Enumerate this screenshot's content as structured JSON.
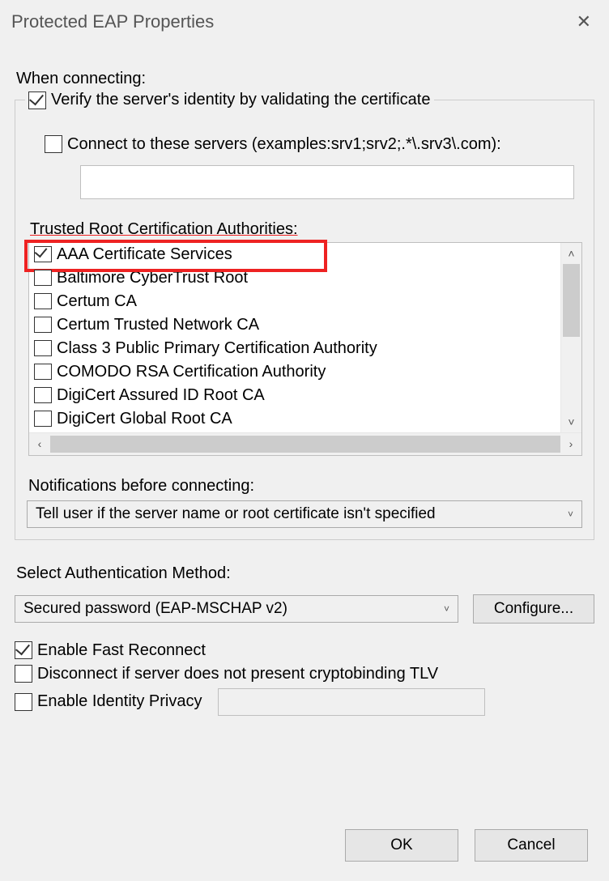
{
  "window": {
    "title": "Protected EAP Properties"
  },
  "main": {
    "when_connecting": "When connecting:",
    "verify_label": "Verify the server's identity by validating the certificate",
    "verify_checked": true,
    "connect_label": "Connect to these servers (examples:srv1;srv2;.*\\.srv3\\.com):",
    "connect_checked": false,
    "connect_value": "",
    "trusted_label": "Trusted Root Certification Authorities:",
    "authorities": [
      {
        "label": "AAA Certificate Services",
        "checked": true,
        "highlighted": true
      },
      {
        "label": "Baltimore CyberTrust Root",
        "checked": false
      },
      {
        "label": "Certum CA",
        "checked": false
      },
      {
        "label": "Certum Trusted Network CA",
        "checked": false
      },
      {
        "label": "Class 3 Public Primary Certification Authority",
        "checked": false
      },
      {
        "label": "COMODO RSA Certification Authority",
        "checked": false
      },
      {
        "label": "DigiCert Assured ID Root CA",
        "checked": false
      },
      {
        "label": "DigiCert Global Root CA",
        "checked": false
      }
    ],
    "notifications_label": "Notifications before connecting:",
    "notifications_value": "Tell user if the server name or root certificate isn't specified"
  },
  "auth": {
    "label": "Select Authentication Method:",
    "value": "Secured password (EAP-MSCHAP v2)",
    "configure": "Configure..."
  },
  "options": {
    "fast_reconnect": {
      "label": "Enable Fast Reconnect",
      "checked": true
    },
    "cryptobinding": {
      "label": "Disconnect if server does not present cryptobinding TLV",
      "checked": false
    },
    "identity_privacy": {
      "label": "Enable Identity Privacy",
      "checked": false,
      "value": ""
    }
  },
  "buttons": {
    "ok": "OK",
    "cancel": "Cancel"
  }
}
